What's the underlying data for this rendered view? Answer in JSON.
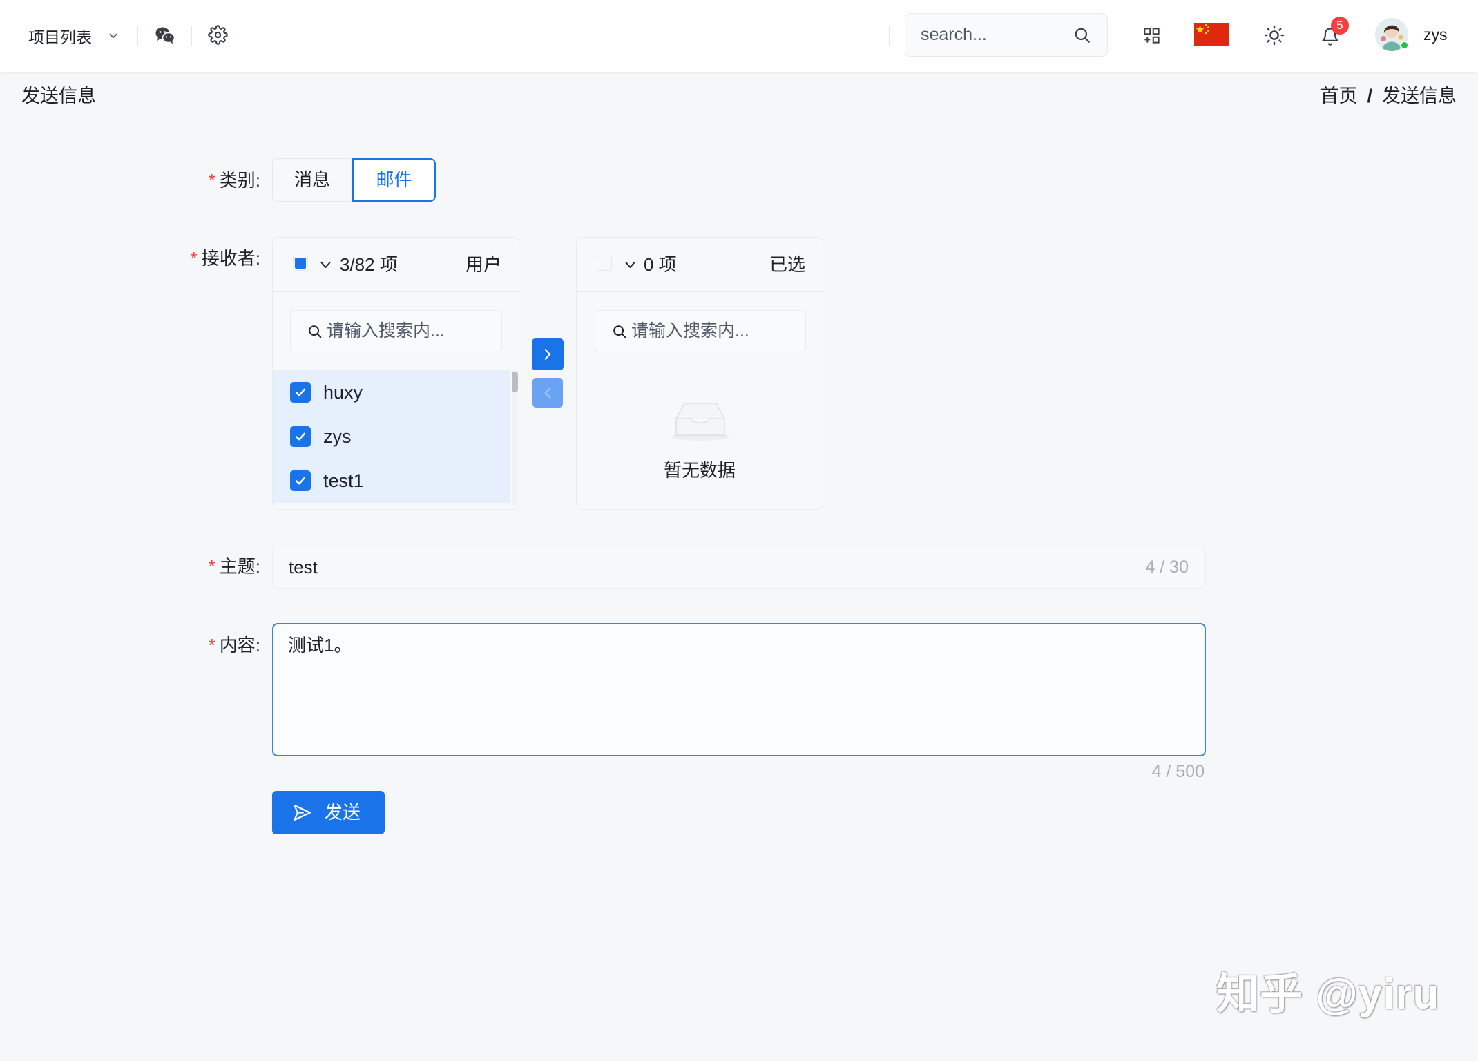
{
  "header": {
    "project_menu_label": "项目列表",
    "search_placeholder": "search...",
    "notification_count": "5",
    "username": "zys",
    "icons": [
      "chevron-down-icon",
      "wechat-icon",
      "gear-icon",
      "search-icon",
      "apps-grid-icon",
      "china-flag-icon",
      "sun-icon",
      "bell-icon"
    ]
  },
  "page": {
    "title": "发送信息",
    "breadcrumb": {
      "home": "首页",
      "separator": "/",
      "current": "发送信息"
    }
  },
  "form": {
    "required_mark": "*",
    "category": {
      "label": "类别:",
      "options": [
        "消息",
        "邮件"
      ],
      "selected": "邮件"
    },
    "receivers": {
      "label": "接收者:",
      "source": {
        "count": "3/82 项",
        "title": "用户",
        "search_placeholder": "请输入搜索内...",
        "select_all_state": "indeterminate",
        "items": [
          {
            "name": "huxy",
            "checked": true
          },
          {
            "name": "zys",
            "checked": true
          },
          {
            "name": "test1",
            "checked": true
          }
        ]
      },
      "target": {
        "count": "0 项",
        "title": "已选",
        "search_placeholder": "请输入搜索内...",
        "select_all_state": "unchecked",
        "empty_text": "暂无数据"
      },
      "move_right_enabled": true,
      "move_left_enabled": false
    },
    "subject": {
      "label": "主题:",
      "value": "test",
      "counter": "4 / 30"
    },
    "content": {
      "label": "内容:",
      "value": "测试1。",
      "counter": "4 / 500"
    },
    "submit": {
      "label": "发送"
    }
  },
  "watermark": "知乎 @yiru",
  "colors": {
    "primary": "#1a73e8",
    "selected_row_bg": "#e6f0fc",
    "required": "#f53f3f",
    "badge": "#f53f3f",
    "online": "#23c343",
    "focus_border": "#3586d4"
  }
}
